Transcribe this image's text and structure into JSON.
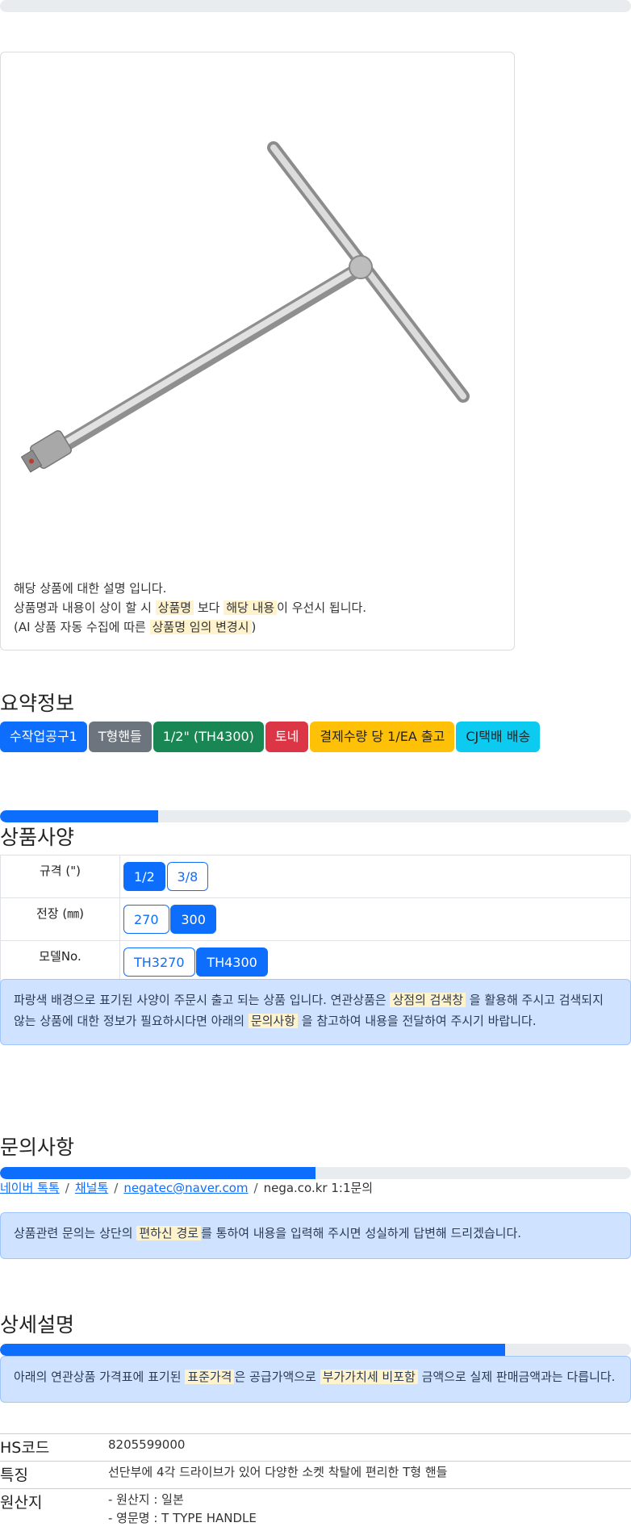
{
  "product_card": {
    "description_lines": [
      "해당 상품에 대한 설명 입니다."
    ],
    "line2_parts": [
      "상품명과 내용이 상이 할 시 ",
      "상품명",
      " 보다 ",
      "해당 내용",
      "이 우선시 됩니다."
    ],
    "line3_parts": [
      "(AI 상품 자동 수집에 따른 ",
      "상품명 임의 변경시",
      ")"
    ]
  },
  "summary": {
    "title": "요약정보",
    "badges": [
      {
        "label": "수작업공구1",
        "color": "#0d6efd",
        "text": "#ffffff"
      },
      {
        "label": "T형핸들",
        "color": "#6c757d",
        "text": "#ffffff"
      },
      {
        "label": "1/2\" (TH4300)",
        "color": "#198754",
        "text": "#ffffff"
      },
      {
        "label": "토네",
        "color": "#dc3545",
        "text": "#ffffff"
      },
      {
        "label": "결제수량 당 1/EA 출고",
        "color": "#ffc107",
        "text": "#222222"
      },
      {
        "label": "CJ택배 배송",
        "color": "#0dcaf0",
        "text": "#222222"
      }
    ]
  },
  "specs": {
    "title": "상품사양",
    "progress": 0.25,
    "rows": [
      {
        "label": "규격 (\")",
        "options": [
          {
            "text": "1/2",
            "selected": true
          },
          {
            "text": "3/8",
            "selected": false
          }
        ]
      },
      {
        "label": "전장 (㎜)",
        "options": [
          {
            "text": "270",
            "selected": false
          },
          {
            "text": "300",
            "selected": true
          }
        ]
      },
      {
        "label": "모델No.",
        "options": [
          {
            "text": "TH3270",
            "selected": false
          },
          {
            "text": "TH4300",
            "selected": true
          }
        ]
      }
    ],
    "notice_parts": [
      "파랑색 배경으로 표기된 사양이 주문시 출고 되는 상품 입니다. 연관상품은 ",
      "상점의 검색창",
      " 을 활용해 주시고 검색되지 않는 상품에 대한 정보가 필요하시다면 아래의 ",
      "문의사항",
      " 을 참고하여 내용을 전달하여 주시기 바랍니다."
    ]
  },
  "inquiry": {
    "title": "문의사항",
    "progress": 0.5,
    "links": [
      "네이버 톡톡",
      "채널톡",
      "negatec@naver.com"
    ],
    "plain": "nega.co.kr 1:1문의",
    "separator": "/",
    "notice_parts": [
      "상품관련 문의는 상단의 ",
      "편하신 경로",
      "를 통하여 내용을 입력해 주시면 성실하게 답변해 드리겠습니다."
    ]
  },
  "detail": {
    "title": "상세설명",
    "progress": 0.8,
    "notice_parts": [
      "아래의 연관상품 가격표에 표기된 ",
      "표준가격",
      "은 공급가액으로 ",
      "부가가치세 비포함",
      " 금액으로 실제 판매금액과는 다릅니다."
    ],
    "rows": [
      {
        "key": "HS코드",
        "value": "8205599000"
      },
      {
        "key": "특징",
        "value": "선단부에 4각 드라이브가 있어 다양한 소켓 착탈에 편리한 T형 핸들"
      },
      {
        "key": "원산지",
        "lines": [
          "- 원산지 : 일본",
          "- 영문명 : T TYPE HANDLE"
        ]
      }
    ]
  }
}
